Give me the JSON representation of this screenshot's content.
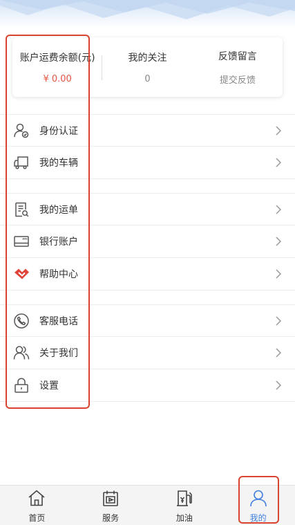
{
  "stats": [
    {
      "title": "账户运费余额(元)",
      "value": "¥ 0.00"
    },
    {
      "title": "我的关注",
      "value": "0"
    },
    {
      "title": "反馈留言",
      "value": "提交反馈"
    }
  ],
  "menu_groups": [
    [
      {
        "label": "身份认证",
        "icon": "id-verify-icon"
      },
      {
        "label": "我的车辆",
        "icon": "truck-icon"
      }
    ],
    [
      {
        "label": "我的运单",
        "icon": "waybill-icon"
      },
      {
        "label": "银行账户",
        "icon": "bank-card-icon"
      },
      {
        "label": "帮助中心",
        "icon": "help-center-icon"
      }
    ],
    [
      {
        "label": "客服电话",
        "icon": "phone-icon"
      },
      {
        "label": "关于我们",
        "icon": "users-icon"
      },
      {
        "label": "设置",
        "icon": "lock-icon"
      }
    ]
  ],
  "bottom_nav": [
    {
      "label": "首页",
      "icon": "home-icon"
    },
    {
      "label": "服务",
      "icon": "service-icon"
    },
    {
      "label": "加油",
      "icon": "fuel-icon"
    },
    {
      "label": "我的",
      "icon": "profile-icon",
      "active": true
    }
  ],
  "colors": {
    "accent": "#3f7fe0",
    "money": "#e8543e",
    "highlight": "#d9432f"
  }
}
